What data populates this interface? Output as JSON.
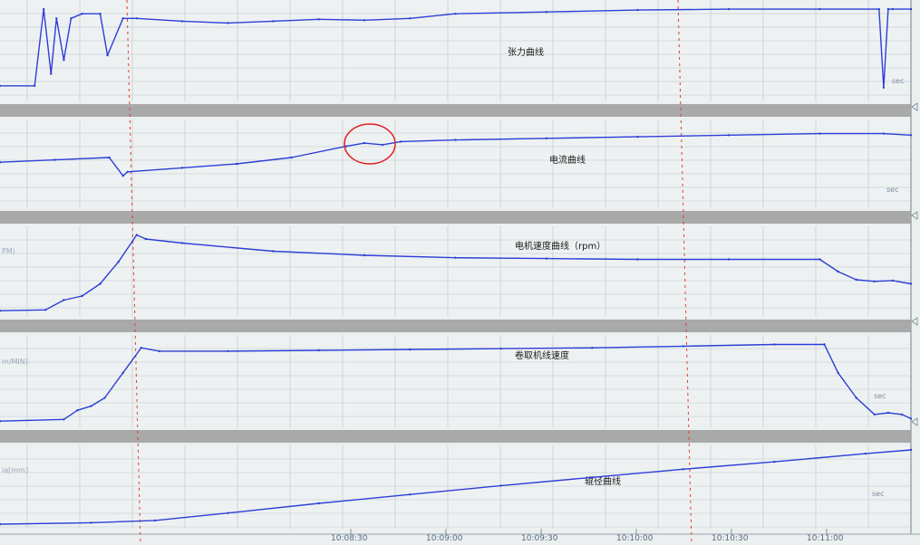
{
  "chart_data": [
    {
      "type": "line",
      "series_label": "张力曲线",
      "unit_label": "",
      "sec_label": "sec",
      "x": [
        0,
        38,
        48,
        56,
        62,
        70,
        78,
        90,
        110,
        118,
        135,
        150,
        200,
        250,
        300,
        350,
        400,
        450,
        500,
        600,
        700,
        800,
        900,
        965,
        970,
        975,
        980,
        1000
      ],
      "y": [
        0.12,
        0.12,
        0.95,
        0.25,
        0.85,
        0.4,
        0.85,
        0.9,
        0.9,
        0.45,
        0.85,
        0.85,
        0.82,
        0.8,
        0.82,
        0.84,
        0.83,
        0.85,
        0.9,
        0.92,
        0.94,
        0.95,
        0.95,
        0.95,
        0.1,
        0.95,
        0.95,
        0.95
      ]
    },
    {
      "type": "line",
      "series_label": "电流曲线",
      "unit_label": "",
      "sec_label": "sec",
      "x": [
        0,
        60,
        120,
        135,
        140,
        200,
        260,
        320,
        380,
        400,
        420,
        440,
        500,
        600,
        700,
        800,
        900,
        970,
        1000
      ],
      "y": [
        0.52,
        0.55,
        0.58,
        0.35,
        0.4,
        0.45,
        0.5,
        0.58,
        0.72,
        0.76,
        0.74,
        0.78,
        0.8,
        0.82,
        0.84,
        0.86,
        0.88,
        0.88,
        0.86
      ]
    },
    {
      "type": "line",
      "series_label": "电机速度曲线（rpm）",
      "unit_label": "PM)",
      "sec_label": "",
      "x": [
        0,
        50,
        70,
        90,
        110,
        130,
        150,
        160,
        200,
        300,
        400,
        500,
        600,
        700,
        800,
        900,
        920,
        940,
        960,
        980,
        1000
      ],
      "y": [
        0.02,
        0.03,
        0.15,
        0.2,
        0.35,
        0.62,
        0.95,
        0.9,
        0.85,
        0.75,
        0.7,
        0.67,
        0.66,
        0.65,
        0.65,
        0.65,
        0.5,
        0.4,
        0.38,
        0.39,
        0.35
      ]
    },
    {
      "type": "line",
      "series_label": "卷取机线速度",
      "unit_label": "m/MIN)",
      "sec_label": "sec",
      "x": [
        0,
        70,
        85,
        100,
        115,
        135,
        155,
        175,
        250,
        350,
        450,
        550,
        650,
        750,
        850,
        905,
        920,
        940,
        960,
        975,
        990,
        1000
      ],
      "y": [
        0.02,
        0.04,
        0.15,
        0.2,
        0.3,
        0.6,
        0.9,
        0.86,
        0.86,
        0.87,
        0.88,
        0.89,
        0.9,
        0.92,
        0.94,
        0.94,
        0.6,
        0.3,
        0.1,
        0.12,
        0.1,
        0.05
      ]
    },
    {
      "type": "line",
      "series_label": "辊径曲线",
      "unit_label": "ia[mm]",
      "sec_label": "sec",
      "x": [
        0,
        100,
        170,
        250,
        350,
        450,
        550,
        650,
        750,
        850,
        950,
        1000
      ],
      "y": [
        0.0,
        0.02,
        0.05,
        0.15,
        0.28,
        0.4,
        0.52,
        0.63,
        0.74,
        0.84,
        0.95,
        1.0
      ]
    },
    {
      "type": "line",
      "shared_x_ticks": [
        "10:08:30",
        "10:09:00",
        "10:09:30",
        "10:10:00",
        "10:10:30",
        "10:11:00"
      ]
    }
  ],
  "colors": {
    "trace": "#2c3fd6",
    "marker": "#e23a2a",
    "grid": "#b9c3cc",
    "band": "#a9a9a9",
    "panel_bg": "#eef1f2"
  }
}
